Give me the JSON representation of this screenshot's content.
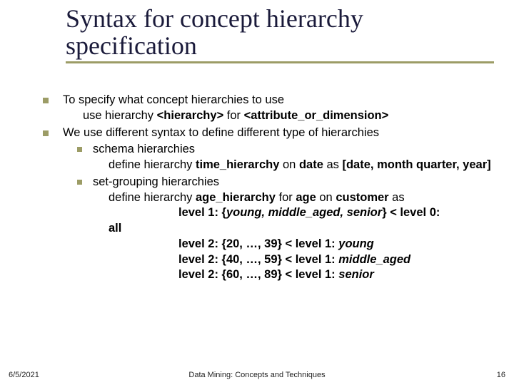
{
  "title": "Syntax for concept hierarchy specification",
  "b1": {
    "line1": "To specify what concept hierarchies to use",
    "line2a": "use hierarchy ",
    "line2b": "<hierarchy>",
    "line2c": " for ",
    "line2d": "<attribute_or_dimension>"
  },
  "b2": {
    "line1": "We use different syntax to define different type of hierarchies",
    "sub1": {
      "label": "schema hierarchies",
      "def_a": "define hierarchy ",
      "def_b": "time_hierarchy",
      "def_c": " on ",
      "def_d": "date",
      "def_e": " as ",
      "def_f": "[date, month quarter, year]"
    },
    "sub2": {
      "label": "set-grouping hierarchies",
      "def_a": "define hierarchy ",
      "def_b": "age_hierarchy",
      "def_c": " for ",
      "def_d": "age",
      "def_e": " on ",
      "def_f": "customer",
      "def_g": " as",
      "lvl1_a": "level 1: {",
      "lvl1_b": "young, middle_aged, senior",
      "lvl1_c": "} < level 0: ",
      "lvl1_d": "all",
      "lvl2a_a": "level 2: {20, …, 39} < level 1: ",
      "lvl2a_b": "young",
      "lvl2b_a": "level 2: {40, …, 59} < level 1: ",
      "lvl2b_b": "middle_aged",
      "lvl2c_a": "level 2: {60, …, 89} < level 1: ",
      "lvl2c_b": "senior"
    }
  },
  "footer": {
    "date": "6/5/2021",
    "center": "Data Mining: Concepts and Techniques",
    "num": "16"
  }
}
